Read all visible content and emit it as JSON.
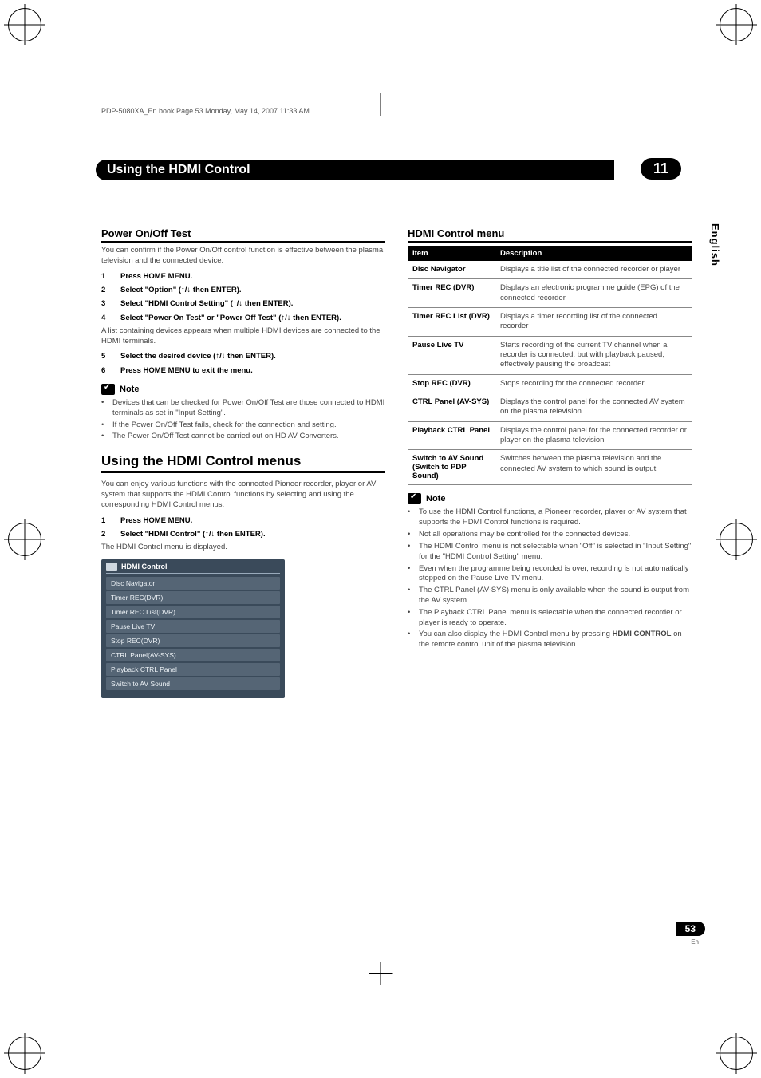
{
  "page_header": "PDP-5080XA_En.book  Page 53  Monday, May 14, 2007  11:33 AM",
  "chapter": {
    "title": "Using the HDMI Control",
    "number": "11"
  },
  "side_tab": "English",
  "page_number": "53",
  "page_lang": "En",
  "left": {
    "section_power": {
      "heading": "Power On/Off Test",
      "intro": "You can confirm if the Power On/Off control function is effective between the plasma television and the connected device.",
      "steps": [
        {
          "n": "1",
          "t": "Press HOME MENU."
        },
        {
          "n": "2",
          "t": "Select \"Option\" (↑/↓ then ENTER)."
        },
        {
          "n": "3",
          "t": "Select \"HDMI Control Setting\" (↑/↓ then ENTER)."
        },
        {
          "n": "4",
          "t": "Select \"Power On Test\" or \"Power Off Test\" (↑/↓ then ENTER)."
        }
      ],
      "after4": "A list containing devices appears when multiple HDMI devices are connected to the HDMI terminals.",
      "steps2": [
        {
          "n": "5",
          "t": "Select the desired device (↑/↓ then ENTER)."
        },
        {
          "n": "6",
          "t": "Press HOME MENU to exit the menu."
        }
      ],
      "note_label": "Note",
      "notes": [
        "Devices that can be checked for Power On/Off Test are those connected to HDMI terminals as set in \"Input Setting\".",
        "If the Power On/Off Test fails, check for the connection and setting.",
        "The Power On/Off Test cannot be carried out on HD AV Converters."
      ]
    },
    "section_menus": {
      "heading": "Using the HDMI Control menus",
      "intro": "You can enjoy various functions with the connected Pioneer recorder, player or AV system that supports the HDMI Control functions by selecting and using the corresponding HDMI Control menus.",
      "steps": [
        {
          "n": "1",
          "t": "Press HOME MENU."
        },
        {
          "n": "2",
          "t": "Select \"HDMI Control\" (↑/↓ then ENTER)."
        }
      ],
      "after": "The HDMI Control menu is displayed.",
      "menu_title": "HDMI Control",
      "menu_items": [
        "Disc Navigator",
        "Timer REC(DVR)",
        "Timer REC List(DVR)",
        "Pause Live TV",
        "Stop REC(DVR)",
        "CTRL Panel(AV-SYS)",
        "Playback CTRL Panel",
        "Switch to AV Sound"
      ]
    }
  },
  "right": {
    "heading": "HDMI Control menu",
    "th_item": "Item",
    "th_desc": "Description",
    "rows": [
      {
        "k": "Disc Navigator",
        "d": "Displays a title list of the connected recorder or player"
      },
      {
        "k": "Timer REC (DVR)",
        "d": "Displays an electronic programme guide (EPG) of the connected recorder"
      },
      {
        "k": "Timer REC List (DVR)",
        "d": "Displays a timer recording list of the connected recorder"
      },
      {
        "k": "Pause Live TV",
        "d": "Starts recording of the current TV channel when a recorder is connected, but with playback paused, effectively pausing the broadcast"
      },
      {
        "k": "Stop REC (DVR)",
        "d": "Stops recording for the connected recorder"
      },
      {
        "k": "CTRL Panel (AV-SYS)",
        "d": "Displays the control panel for the connected AV system on the plasma television"
      },
      {
        "k": "Playback CTRL Panel",
        "d": "Displays the control panel for the connected recorder or player on the plasma television"
      },
      {
        "k": "Switch to AV Sound (Switch to PDP Sound)",
        "d": "Switches between the plasma television and the connected AV system to which sound is output"
      }
    ],
    "note_label": "Note",
    "notes": [
      "To use the HDMI Control functions, a Pioneer recorder, player or AV system that supports the HDMI Control functions is required.",
      "Not all operations may be controlled for the connected devices.",
      "The HDMI Control menu is not selectable when \"Off\" is selected in \"Input Setting\" for the \"HDMI Control Setting\" menu.",
      "Even when the programme being recorded is over, recording is not automatically stopped on the Pause Live TV menu.",
      "The CTRL Panel (AV-SYS) menu is only available when the sound is output from the AV system.",
      "The Playback CTRL Panel menu is selectable when the connected recorder or player is ready to operate."
    ],
    "note_last_pre": "You can also display the HDMI Control menu by pressing ",
    "note_last_bold": "HDMI CONTROL",
    "note_last_post": " on the remote control unit of the plasma television."
  }
}
